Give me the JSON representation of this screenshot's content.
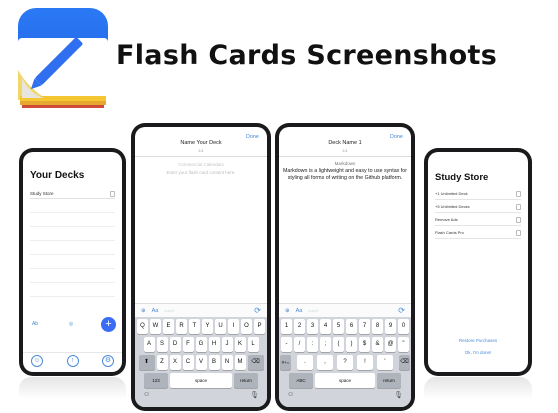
{
  "header": {
    "title": "Flash Cards Screenshots"
  },
  "app_icon": {
    "name": "pencil-notepad-app-icon",
    "accent": "#2f6ff0"
  },
  "phone1": {
    "title": "Your Decks",
    "deck": "Study Store",
    "toolbar_left": "Ab",
    "fab_label": "+",
    "bottom_left": "☺",
    "bottom_mid": "↑",
    "bottom_right": "⚙"
  },
  "phone2": {
    "done": "Done",
    "title": "Name Your Deck",
    "sub": "1/1",
    "placeholder_label": "Commercial Calendars",
    "placeholder_text": "Enter your flash card content here.",
    "tool_plus": "⊕",
    "tool_aa": "Aa",
    "tool_mid": "Insert",
    "tool_right": "⟳",
    "kb_row1": [
      "Q",
      "W",
      "E",
      "R",
      "T",
      "Y",
      "U",
      "I",
      "O",
      "P"
    ],
    "kb_row2": [
      "A",
      "S",
      "D",
      "F",
      "G",
      "H",
      "J",
      "K",
      "L"
    ],
    "kb_row3": [
      "Z",
      "X",
      "C",
      "V",
      "B",
      "N",
      "M"
    ],
    "kb_shift": "⬆",
    "kb_delete": "⌫",
    "kb_123": "123",
    "kb_space": "space",
    "kb_return": "return",
    "kb_emoji": "☺",
    "kb_mic": "🎙"
  },
  "phone3": {
    "done": "Done",
    "title": "Deck Name 1",
    "sub": "1/1",
    "label": "Markdown",
    "text": "Markdown is a lightweight and easy to use syntax for styling all forms of writing on the Github platform.",
    "tool_plus": "⊕",
    "tool_aa": "Aa",
    "tool_mid": "Insert",
    "tool_right": "⟳",
    "kb_row1": [
      "1",
      "2",
      "3",
      "4",
      "5",
      "6",
      "7",
      "8",
      "9",
      "0"
    ],
    "kb_row2": [
      "-",
      "/",
      ":",
      ";",
      "(",
      ")",
      "$",
      "&",
      "@",
      "\""
    ],
    "kb_row3": [
      ".",
      ",",
      "?",
      "!",
      "'"
    ],
    "kb_redo": "#+=",
    "kb_delete": "⌫",
    "kb_abc": "ABC",
    "kb_space": "space",
    "kb_return": "return",
    "kb_emoji": "☺",
    "kb_mic": "🎙"
  },
  "phone4": {
    "title": "Study Store",
    "items": [
      "+1 Unlimited Deck",
      "+5 Unlimited Decks",
      "Remove Ads",
      "Flash Cards Pro"
    ],
    "restore": "Restore Purchases",
    "ok": "Ok, I'm done!"
  }
}
